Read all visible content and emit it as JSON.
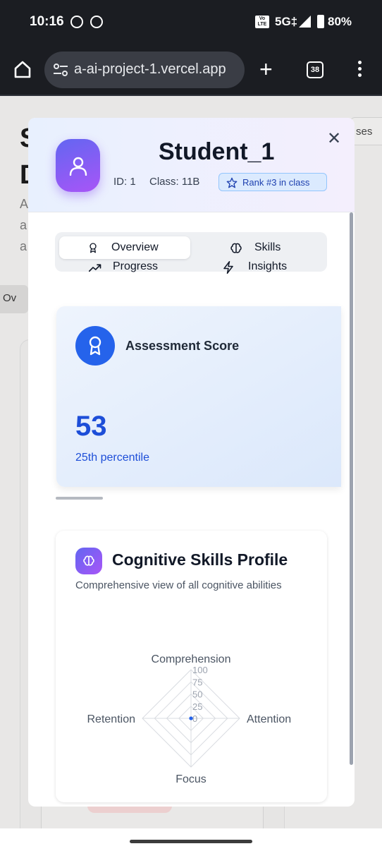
{
  "status_bar": {
    "time": "10:16",
    "volte": "Vo\nLTE",
    "network": "5G‡",
    "battery": "80%"
  },
  "browser": {
    "url": "a-ai-project-1.vercel.app",
    "tab_count": "38"
  },
  "background_page": {
    "title": "S\nD",
    "text": "A\na\na",
    "right_button": "ses",
    "tab_label": "Ov"
  },
  "modal": {
    "student_name": "Student_1",
    "id_text": "ID: 1",
    "class_text": "Class: 11B",
    "rank_text": "Rank #3 in class",
    "tabs": [
      {
        "label": "Overview",
        "icon": "award-icon",
        "active": true
      },
      {
        "label": "Skills",
        "icon": "brain-icon",
        "active": false
      },
      {
        "label": "Progress",
        "icon": "trending-up-icon",
        "active": false
      },
      {
        "label": "Insights",
        "icon": "zap-icon",
        "active": false
      }
    ],
    "score_card": {
      "title": "Assessment Score",
      "value": "53",
      "percentile": "25th percentile"
    },
    "skills_card": {
      "title": "Cognitive Skills Profile",
      "subtitle": "Comprehensive view of all cognitive abilities"
    }
  },
  "chart_data": {
    "type": "radar",
    "axes": [
      "Comprehension",
      "Attention",
      "Focus",
      "Retention"
    ],
    "ticks": [
      "100",
      "75",
      "50",
      "25",
      "0"
    ],
    "range": [
      0,
      100
    ],
    "values": [
      0,
      0,
      0,
      0
    ],
    "series_color": "#2563eb"
  },
  "colors": {
    "accent_blue": "#2563eb",
    "purple": "#a855f7",
    "indigo": "#6366f1"
  }
}
